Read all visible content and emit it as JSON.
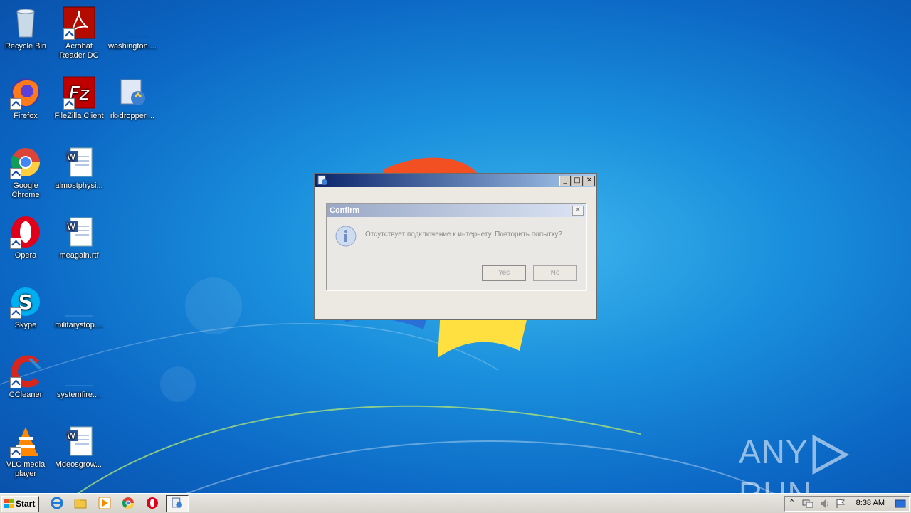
{
  "desktop": {
    "icons": [
      {
        "label": "Recycle Bin",
        "icon": "recycle-bin-icon"
      },
      {
        "label": "Acrobat Reader DC",
        "icon": "acrobat-icon"
      },
      {
        "label": "washington....",
        "icon": "blank-file-icon"
      },
      {
        "label": "Firefox",
        "icon": "firefox-icon"
      },
      {
        "label": "FileZilla Client",
        "icon": "filezilla-icon"
      },
      {
        "label": "rk-dropper....",
        "icon": "installer-icon"
      },
      {
        "label": "Google Chrome",
        "icon": "chrome-icon"
      },
      {
        "label": "almostphysi...",
        "icon": "word-doc-icon"
      },
      {
        "label": "Opera",
        "icon": "opera-icon"
      },
      {
        "label": "meagain.rtf",
        "icon": "word-doc-icon"
      },
      {
        "label": "Skype",
        "icon": "skype-icon"
      },
      {
        "label": "militarystop....",
        "icon": "blank-file-icon"
      },
      {
        "label": "CCleaner",
        "icon": "ccleaner-icon"
      },
      {
        "label": "systemfire....",
        "icon": "blank-file-icon"
      },
      {
        "label": "VLC media player",
        "icon": "vlc-icon"
      },
      {
        "label": "videosgrow...",
        "icon": "word-doc-icon"
      }
    ]
  },
  "dialog": {
    "window_title": "",
    "confirm": {
      "title": "Confirm",
      "message": "Отсутствует подключение к интернету. Повторить попытку?",
      "yes_label": "Yes",
      "no_label": "No"
    },
    "window_buttons": {
      "minimize": "_",
      "maximize": "□",
      "close": "✕"
    }
  },
  "watermark": {
    "text_left": "ANY",
    "text_right": "RUN"
  },
  "taskbar": {
    "start_label": "Start",
    "clock": "8:38 AM"
  }
}
